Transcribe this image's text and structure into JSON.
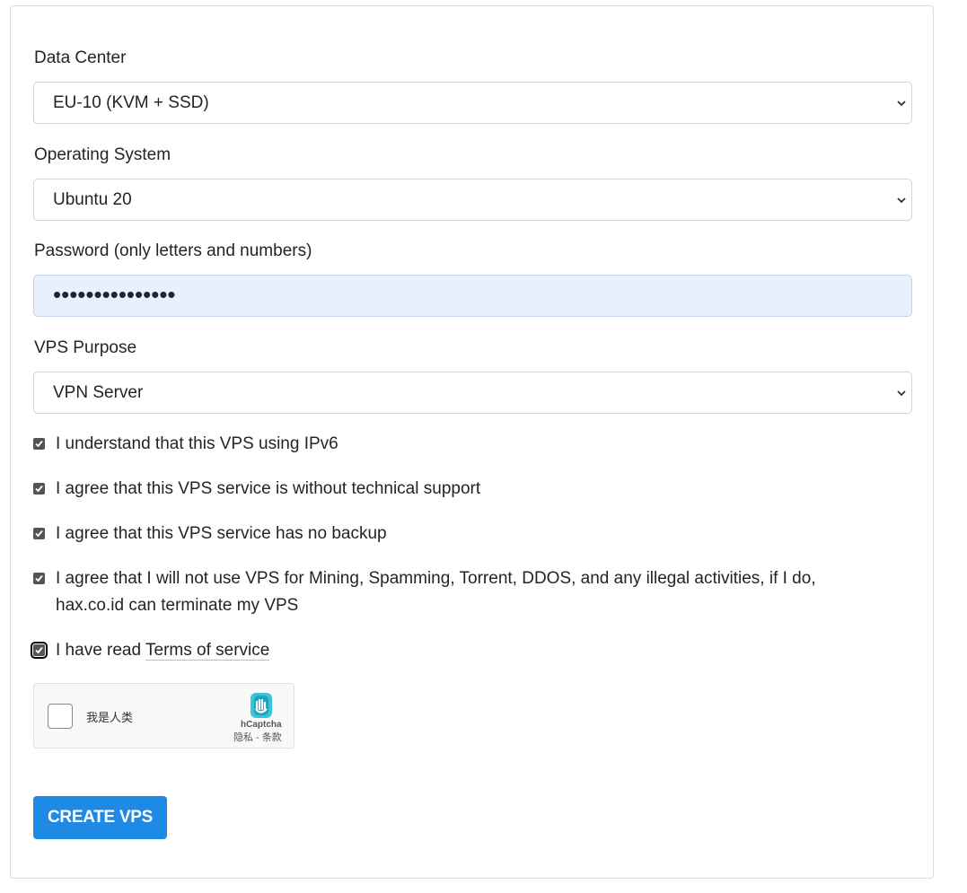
{
  "form": {
    "data_center": {
      "label": "Data Center",
      "value": "EU-10 (KVM + SSD)"
    },
    "operating_system": {
      "label": "Operating System",
      "value": "Ubuntu 20"
    },
    "password": {
      "label": "Password (only letters and numbers)",
      "value": "•••••••••••••••"
    },
    "vps_purpose": {
      "label": "VPS Purpose",
      "value": "VPN Server"
    },
    "checkboxes": [
      {
        "text": "I understand that this VPS using IPv6",
        "checked": true
      },
      {
        "text": "I agree that this VPS service is without technical support",
        "checked": true
      },
      {
        "text": "I agree that this VPS service has no backup",
        "checked": true
      },
      {
        "text_line1": "I agree that I will not use VPS for Mining, Spamming, Torrent, DDOS, and any illegal activities, if I do,",
        "text_line2": "hax.co.id can terminate my VPS",
        "checked": true
      },
      {
        "text": "I have read",
        "link": "Terms of service",
        "checked": true
      }
    ],
    "captcha": {
      "label": "我是人类",
      "brand": "hCaptcha",
      "links": "隐私 - 条款"
    },
    "submit_label": "CREATE VPS"
  },
  "colors": {
    "accent": "#1e8ae6",
    "autofill": "#e8f0fe",
    "checkbox": "#545454"
  },
  "icons": [
    "chevron-down-icon",
    "checkmark-icon",
    "hcaptcha-logo-icon"
  ]
}
